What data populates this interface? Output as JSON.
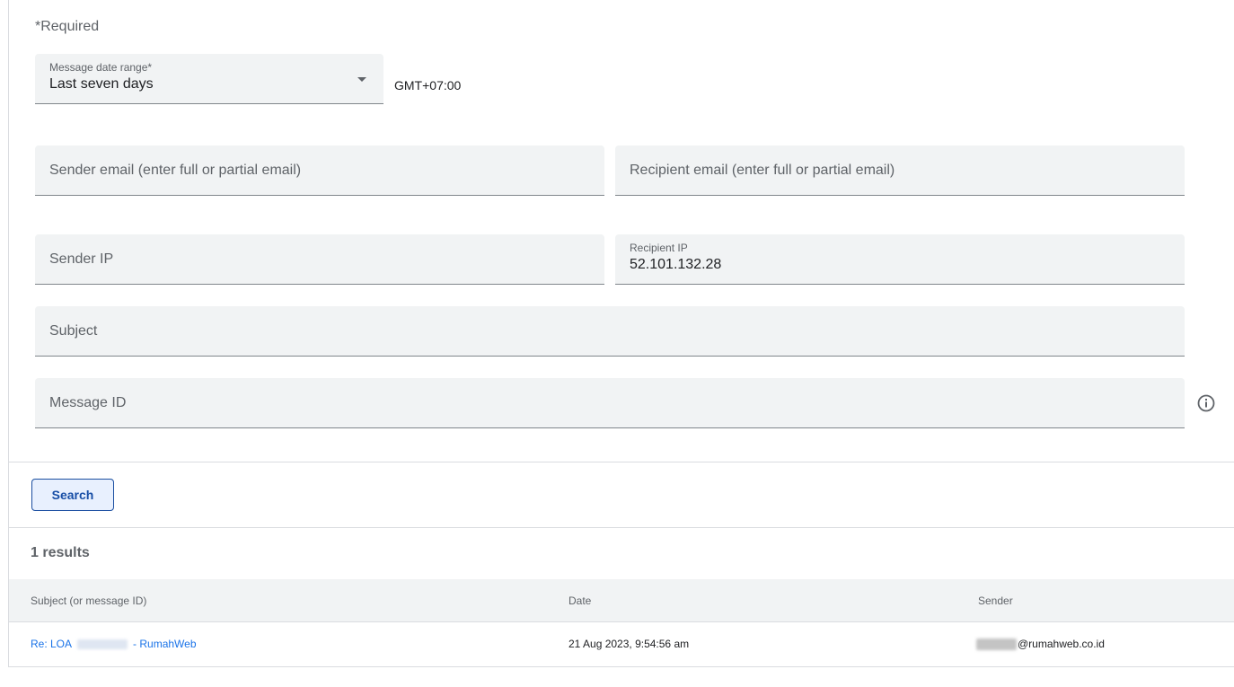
{
  "form": {
    "required_note": "*Required",
    "date_range": {
      "label": "Message date range*",
      "value": "Last seven days"
    },
    "timezone": "GMT+07:00",
    "sender_email": {
      "placeholder": "Sender email (enter full or partial email)"
    },
    "recipient_email": {
      "placeholder": "Recipient email (enter full or partial email)"
    },
    "sender_ip": {
      "placeholder": "Sender IP"
    },
    "recipient_ip": {
      "label": "Recipient IP",
      "value": "52.101.132.28"
    },
    "subject": {
      "placeholder": "Subject"
    },
    "message_id": {
      "placeholder": "Message ID"
    },
    "info_icon": "info-icon",
    "search_label": "Search"
  },
  "results": {
    "count_text": "1 results",
    "columns": [
      "Subject (or message ID)",
      "Date",
      "Sender"
    ],
    "rows": [
      {
        "subject_prefix": "Re: LOA",
        "subject_suffix": "- RumahWeb",
        "date": "21 Aug 2023, 9:54:56 am",
        "sender_domain": "@rumahweb.co.id"
      }
    ]
  },
  "colors": {
    "field_bg": "#f1f3f4",
    "accent": "#1a73e8",
    "button_border": "#1a4ea0",
    "button_bg": "#e8f0fe"
  }
}
